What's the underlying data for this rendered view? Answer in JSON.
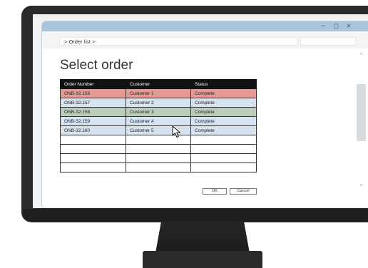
{
  "window": {
    "controls": {
      "minimize": "−",
      "maximize": "◻",
      "close": "×"
    }
  },
  "breadcrumb": {
    "text": "> Order list >"
  },
  "page": {
    "title": "Select order"
  },
  "table": {
    "headers": [
      "Order Number",
      "Customer",
      "Status"
    ],
    "rows": [
      {
        "order": "ONB-32.156",
        "customer": "Customer 1",
        "status": "Complete",
        "state": "selected"
      },
      {
        "order": "ONB-32.157",
        "customer": "Customer 2",
        "status": "Complete",
        "state": "normal"
      },
      {
        "order": "ONB-32.158",
        "customer": "Customer 3",
        "status": "Complete",
        "state": "hover"
      },
      {
        "order": "ONB-32.159",
        "customer": "Customer 4",
        "status": "Complete",
        "state": "normal"
      },
      {
        "order": "ONB-32.160",
        "customer": "Customer 5",
        "status": "Complete",
        "state": "normal"
      }
    ]
  },
  "buttons": {
    "ok": "OK",
    "cancel": "Cancel"
  },
  "scrollbar": {
    "up_icon": "˄",
    "down_icon": "˅"
  },
  "colors": {
    "titlebar": "#a9c3dc",
    "selected_row": "#e59b93",
    "hover_row": "#b9cdb9",
    "normal_row": "#d6e2ee",
    "header_bg": "#111111"
  }
}
